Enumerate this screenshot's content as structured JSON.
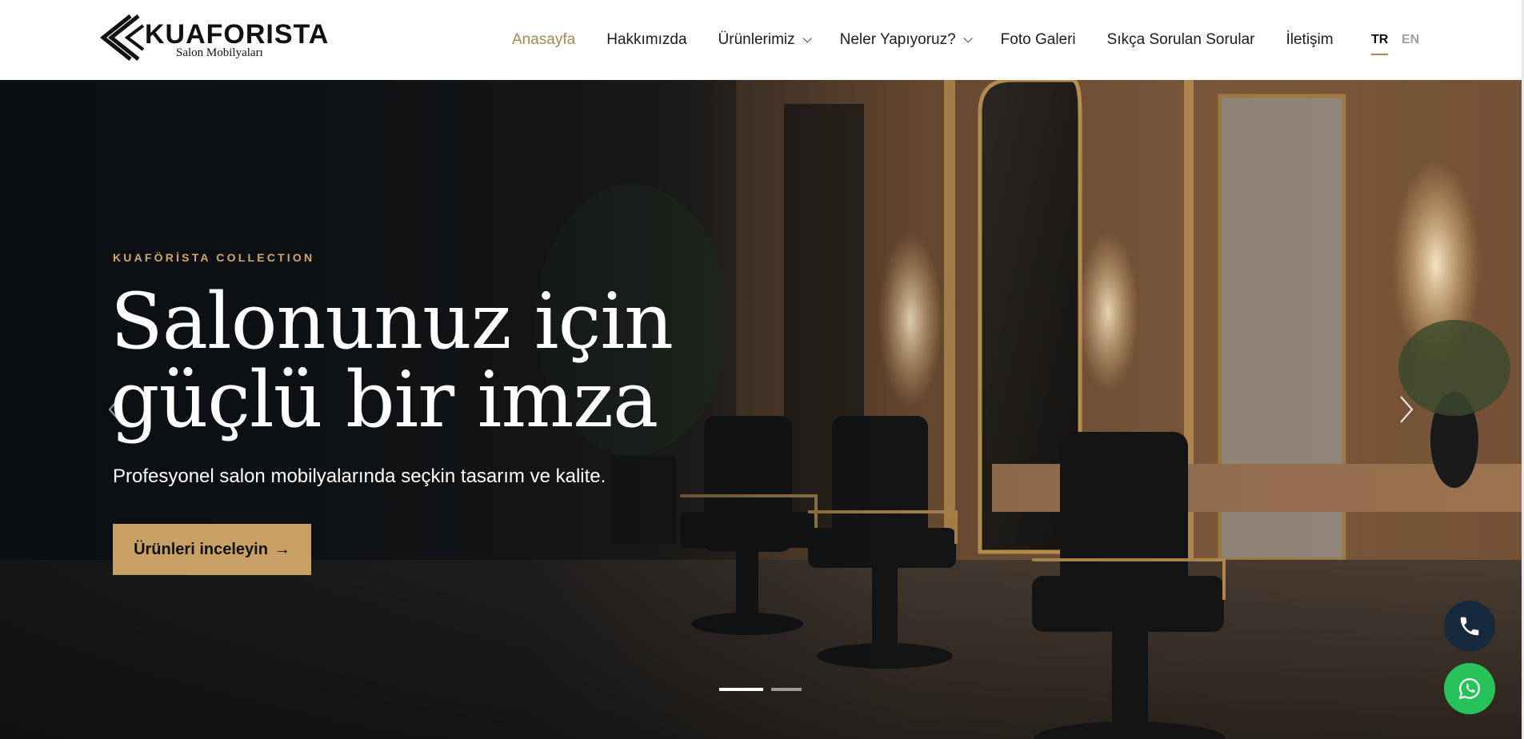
{
  "brand": {
    "name": "KUAFORISTA",
    "tagline": "Salon Mobilyaları"
  },
  "nav": {
    "items": [
      {
        "label": "Anasayfa",
        "active": true
      },
      {
        "label": "Hakkımızda"
      },
      {
        "label": "Ürünlerimiz",
        "dropdown": true
      },
      {
        "label": "Neler Yapıyoruz?",
        "dropdown": true
      },
      {
        "label": "Foto Galeri"
      },
      {
        "label": "Sıkça Sorulan Sorular"
      },
      {
        "label": "İletişim"
      }
    ],
    "languages": {
      "current": "TR",
      "other": "EN"
    }
  },
  "hero": {
    "kicker": "KUAFÖRİSTA COLLECTION",
    "headline_line1": "Salonunuz için",
    "headline_line2": "güçlü bir imza",
    "subline": "Profesyonel salon mobilyalarında seçkin tasarım ve kalite.",
    "cta_label": "Ürünleri inceleyin",
    "cta_arrow": "→",
    "slides": {
      "total": 2,
      "current": 1
    }
  },
  "icons": {
    "prev": "chevron-left-icon",
    "next": "chevron-right-icon",
    "phone": "phone-icon",
    "whatsapp": "whatsapp-icon"
  },
  "colors": {
    "accent_gold": "#c8a066",
    "nav_active": "#a9874f",
    "phone_button": "#17293d",
    "whatsapp_button": "#27c35a"
  }
}
